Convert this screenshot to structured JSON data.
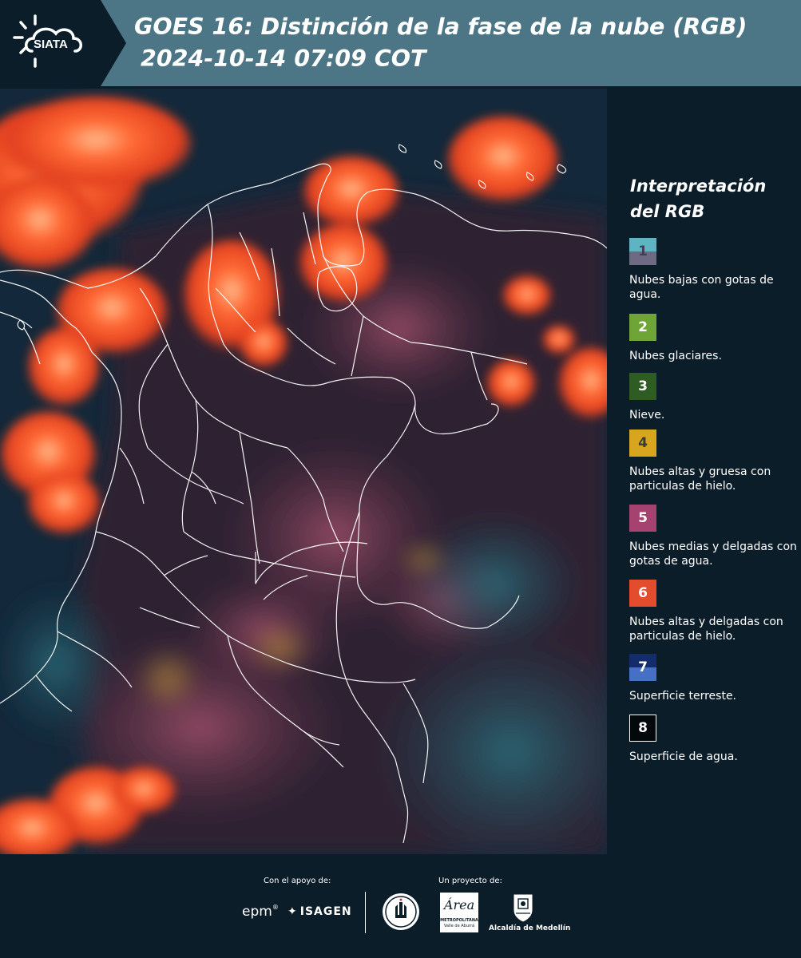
{
  "header": {
    "logo_text": "SIATA",
    "title": "GOES 16: Distinción de la fase de la nube (RGB)",
    "timestamp": "2024-10-14 07:09 COT"
  },
  "legend": {
    "title": "Interpretación del RGB",
    "items": [
      {
        "num": "1",
        "desc": "Nubes bajas con gotas de agua.",
        "color_top": "#5fb4c4",
        "color_bottom": "#6e6a84",
        "num_color": "#3f3f55"
      },
      {
        "num": "2",
        "desc": "Nubes glaciares.",
        "color_top": "#6fa536",
        "color_bottom": "#6fa536",
        "num_color": "#ffffff"
      },
      {
        "num": "3",
        "desc": "Nieve.",
        "color_top": "#2e5c22",
        "color_bottom": "#2e5c22",
        "num_color": "#ffffff"
      },
      {
        "num": "4",
        "desc": "Nubes altas y gruesa con particulas de hielo.",
        "color_top": "#d8a61e",
        "color_bottom": "#d8a61e",
        "num_color": "#3a3a3a"
      },
      {
        "num": "5",
        "desc": "Nubes medias y delgadas con gotas de agua.",
        "color_top": "#a5426f",
        "color_bottom": "#a5426f",
        "num_color": "#ffffff"
      },
      {
        "num": "6",
        "desc": "Nubes altas y delgadas con particulas de hielo.",
        "color_top": "#e34c2c",
        "color_bottom": "#e34c2c",
        "num_color": "#ffffff"
      },
      {
        "num": "7",
        "desc": "Superficie terreste.",
        "color_top": "#142b6c",
        "color_bottom": "#4670c4",
        "num_color": "#ffffff"
      },
      {
        "num": "8",
        "desc": "Superficie de agua.",
        "color_top": "#03080a",
        "color_bottom": "#03080a",
        "num_color": "#ffffff"
      }
    ]
  },
  "footer": {
    "support_caption": "Con el apoyo de:",
    "project_caption": "Un proyecto de:",
    "epm_text": "epm",
    "isagen_text": "ISAGEN",
    "metro_logo_text": "Área",
    "metro_line1": "METROPOLITANA",
    "metro_line2": "Valle de Aburrá",
    "alcaldia_text": "Alcaldía de Medellín"
  },
  "map": {
    "icon": "satellite-rgb-map",
    "ocean_color": "#122838",
    "land_color": "#2a2232",
    "cloud_color": "#ff5a2a",
    "border_color": "#ffffff"
  }
}
